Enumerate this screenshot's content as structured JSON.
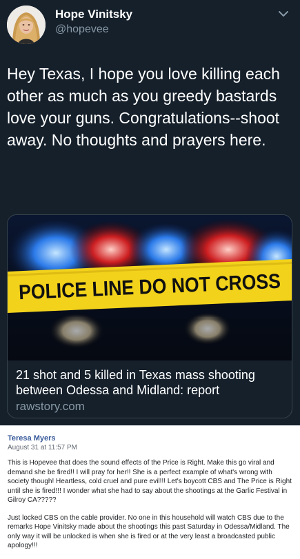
{
  "tweet": {
    "display_name": "Hope Vinitsky",
    "handle": "@hopevee",
    "text": "Hey Texas, I hope you love killing each other as much as you greedy bastards love your guns. Congratulations--shoot away. No thoughts and prayers here.",
    "card": {
      "image_caption": "POLICE LINE DO NOT CROSS",
      "headline": "21 shot and 5 killed in Texas mass shooting between Odessa and Midland: report",
      "domain": "rawstory.com"
    },
    "menu_icon": "chevron-down-icon"
  },
  "comment": {
    "author": "Teresa Myers",
    "timestamp": "August 31 at 11:57 PM",
    "paragraphs": [
      "This is Hopevee that does the sound effects of the Price is Right. Make this go viral and demand she be fired!! I will pray for her!! She is a perfect example of what's wrong with society though! Heartless, cold cruel and pure evil!!! Let's boycott CBS and The Price is Right until she is fired!!! I wonder what she had to say about the shootings at the Garlic Festival in Gilroy CA?????",
      "Just locked CBS on the cable provider. No one in this household will watch CBS due to the remarks Hope Vinitsky made about the shootings this past Saturday in Odessa/Midland. The only way it will be unlocked is when she is fired or at the very least a broadcasted public apology!!!"
    ]
  },
  "colors": {
    "tweet_bg": "#15202b",
    "secondary_text": "#8899a6",
    "fb_link": "#365899",
    "tape_yellow": "#f2d21b"
  }
}
